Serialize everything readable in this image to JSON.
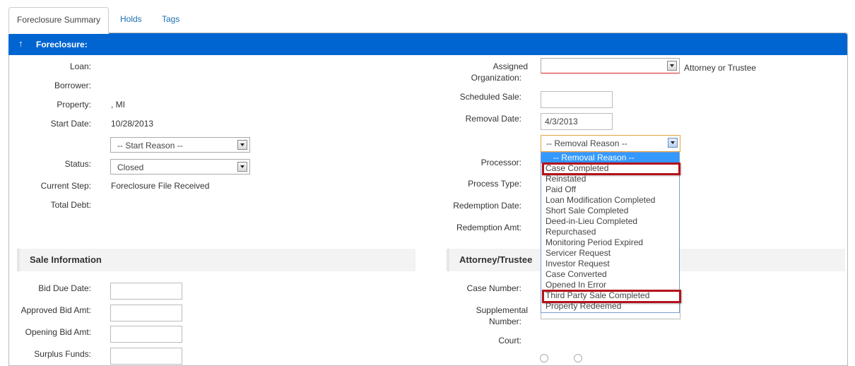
{
  "tabs": [
    {
      "label": "Foreclosure Summary",
      "active": true
    },
    {
      "label": "Holds",
      "active": false
    },
    {
      "label": "Tags",
      "active": false
    }
  ],
  "panel": {
    "title": "Foreclosure: ",
    "arrow": "↑"
  },
  "left_fields": {
    "loan_label": "Loan:",
    "borrower_label": "Borrower:",
    "property_label": "Property:",
    "property_value": ", MI",
    "start_date_label": "Start Date:",
    "start_date_value": "10/28/2013",
    "start_reason_value": "-- Start Reason --",
    "status_label": "Status:",
    "status_value": "Closed",
    "current_step_label": "Current Step:",
    "current_step_value": "Foreclosure File Received",
    "total_debt_label": "Total Debt:"
  },
  "right_fields": {
    "assigned_org_label_1": "Assigned",
    "assigned_org_label_2": "Organization:",
    "assigned_org_value": "",
    "assigned_org_note": "Attorney or Trustee",
    "scheduled_sale_label": "Scheduled Sale:",
    "removal_date_label": "Removal Date:",
    "removal_date_value": "4/3/2013",
    "removal_reason_value": "-- Removal Reason --",
    "processor_label": "Processor:",
    "process_type_label": "Process Type:",
    "redemption_date_label": "Redemption Date:",
    "redemption_amt_label": "Redemption Amt:"
  },
  "sale_info": {
    "title": "Sale Information",
    "bid_due_date_label": "Bid Due Date:",
    "approved_bid_label": "Approved Bid Amt:",
    "opening_bid_label": "Opening Bid Amt:",
    "surplus_funds_label": "Surplus Funds:"
  },
  "attorney": {
    "title": "Attorney/Trustee",
    "case_number_label": "Case Number:",
    "supplemental_label_1": "Supplemental",
    "supplemental_label_2": "Number:",
    "court_label": "Court:"
  },
  "removal_reason_options": [
    "-- Removal Reason --",
    "Case Completed",
    "Reinstated",
    "Paid Off",
    "Loan Modification Completed",
    "Short Sale Completed",
    "Deed-in-Lieu Completed",
    "Repurchased",
    "Monitoring Period Expired",
    "Servicer Request",
    "Investor Request",
    "Case Converted",
    "Opened In Error",
    "Third Party Sale Completed",
    "Property Redeemed"
  ],
  "colors": {
    "header_blue": "#0065d1",
    "highlight": "#3399ff",
    "annotation_red": "#b5121b",
    "link": "#1e6fb5"
  }
}
